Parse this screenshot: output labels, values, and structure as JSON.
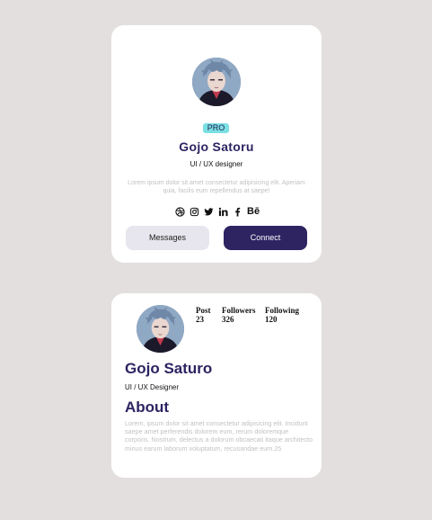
{
  "colors": {
    "background": "#e4dfdf",
    "card": "#ffffff",
    "accent_dark": "#2e2462",
    "badge": "#7be0e4",
    "muted_text": "#c2c2c2"
  },
  "profile_card": {
    "badge": "PRO",
    "name": "Gojo Satoru",
    "role": "UI / UX designer",
    "description": "Lorem ipsum dolor sit amet consectetur adipisicing elit. Aperiam quia, facilis eum repellendus at saepe!",
    "socials": [
      "dribbble-icon",
      "instagram-icon",
      "twitter-icon",
      "linkedin-icon",
      "facebook-icon",
      "behance-icon"
    ],
    "behance_label": "Bē",
    "buttons": {
      "messages": "Messages",
      "connect": "Connect"
    }
  },
  "about_card": {
    "stats": [
      {
        "label": "Post",
        "value": "23"
      },
      {
        "label": "Followers",
        "value": "326"
      },
      {
        "label": "Following",
        "value": "120"
      }
    ],
    "name": "Gojo Saturo",
    "role": "UI / UX Designer",
    "about_title": "About",
    "about_text": "Lorem, ipsum dolor sit amet consectetur adipisicing elit. Incidunt saepe amet perferendis dolorem eum, rerum doloremque corporis. Nostrum, delectus a dolorum obcaecati itaque architecto minus earum laborum voluptatum, recusandae eum.25"
  }
}
